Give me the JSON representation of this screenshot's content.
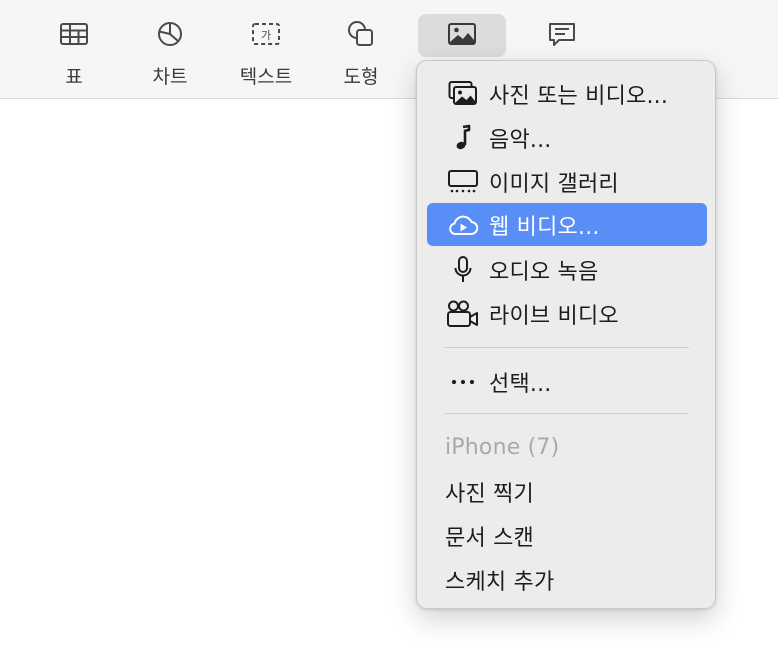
{
  "toolbar": {
    "items": [
      {
        "label": "표",
        "icon": "table-icon"
      },
      {
        "label": "차트",
        "icon": "chart-icon"
      },
      {
        "label": "텍스트",
        "icon": "text-box-icon",
        "glyph": "가"
      },
      {
        "label": "도형",
        "icon": "shape-icon"
      },
      {
        "label": "",
        "icon": "media-icon"
      },
      {
        "label": "",
        "icon": "comment-icon"
      }
    ]
  },
  "menu": {
    "items": [
      {
        "label": "사진 또는 비디오...",
        "icon": "photo-library-icon"
      },
      {
        "label": "음악...",
        "icon": "music-note-icon"
      },
      {
        "label": "이미지 갤러리",
        "icon": "image-gallery-icon"
      },
      {
        "label": "웹 비디오...",
        "icon": "cloud-play-icon",
        "selected": true
      },
      {
        "label": "오디오 녹음",
        "icon": "microphone-icon"
      },
      {
        "label": "라이브 비디오",
        "icon": "video-camera-icon"
      },
      {
        "label": "선택...",
        "icon": "ellipsis-icon"
      },
      {
        "label": "iPhone (7)",
        "disabled": true
      },
      {
        "label": "사진 찍기"
      },
      {
        "label": "문서 스캔"
      },
      {
        "label": "스케치 추가"
      }
    ]
  },
  "colors": {
    "selection": "#5a8ef7",
    "menu_background": "#ececec",
    "toolbar_background": "#f6f6f6",
    "disabled_text": "#a9a9ab"
  }
}
